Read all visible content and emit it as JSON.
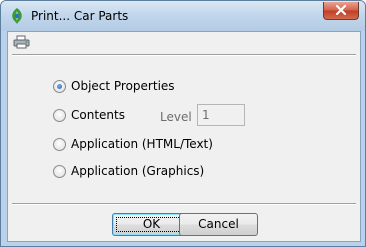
{
  "window": {
    "title": "Print... Car Parts",
    "app_icon": "recycle-leaf-icon",
    "close_icon": "close-icon"
  },
  "toolbar": {
    "printer_icon": "printer-icon"
  },
  "options": [
    {
      "label": "Object Properties",
      "selected": true
    },
    {
      "label": "Contents",
      "selected": false
    },
    {
      "label": "Application (HTML/Text)",
      "selected": false
    },
    {
      "label": "Application (Graphics)",
      "selected": false
    }
  ],
  "level": {
    "label": "Level",
    "value": "1",
    "enabled": false
  },
  "buttons": {
    "ok_label": "OK",
    "cancel_label": "Cancel"
  },
  "colors": {
    "titlebar": "#c2d7ec",
    "close_button": "#c8452c",
    "dialog_bg": "#f0f0f0",
    "radio_selected": "#1d5aa8"
  }
}
